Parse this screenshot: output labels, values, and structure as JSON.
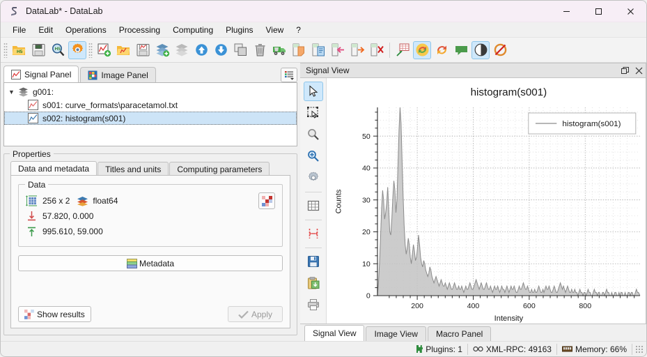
{
  "window": {
    "title": "DataLab* - DataLab",
    "app_icon": "datalab-icon",
    "minimize_label": "—",
    "maximize_label": "☐",
    "close_label": "✕"
  },
  "menubar": {
    "items": [
      {
        "label": "File"
      },
      {
        "label": "Edit"
      },
      {
        "label": "Operations"
      },
      {
        "label": "Processing"
      },
      {
        "label": "Computing"
      },
      {
        "label": "Plugins"
      },
      {
        "label": "View"
      },
      {
        "label": "?"
      }
    ]
  },
  "toolbar": {
    "groups": [
      [
        {
          "name": "open-hdf5-button",
          "icon": "folder-open-h5-icon"
        },
        {
          "name": "save-hdf5-button",
          "icon": "floppy-save-h5-icon"
        },
        {
          "name": "browse-hdf5-button",
          "icon": "magnifier-h5-icon"
        },
        {
          "name": "settings-button",
          "icon": "gear-orange-icon",
          "active": true
        }
      ],
      [
        {
          "name": "new-signal-button",
          "icon": "new-signal-icon"
        },
        {
          "name": "open-signal-button",
          "icon": "folder-signal-icon"
        },
        {
          "name": "save-signal-button",
          "icon": "floppy-signal-icon"
        },
        {
          "name": "new-group-button",
          "icon": "layers-add-icon"
        },
        {
          "name": "group-button",
          "icon": "layers-icon"
        },
        {
          "name": "move-up-button",
          "icon": "arrow-up-circle-icon"
        },
        {
          "name": "move-down-button",
          "icon": "arrow-down-circle-icon"
        },
        {
          "name": "duplicate-button",
          "icon": "duplicate-icon"
        },
        {
          "name": "delete-button",
          "icon": "trash-icon"
        },
        {
          "name": "delete-all-button",
          "icon": "truck-icon"
        },
        {
          "name": "copy-metadata-button",
          "icon": "copy-metadata-icon"
        },
        {
          "name": "paste-metadata-button",
          "icon": "paste-metadata-icon"
        },
        {
          "name": "import-metadata-button",
          "icon": "import-arrow-icon"
        },
        {
          "name": "export-metadata-button",
          "icon": "export-arrow-icon"
        },
        {
          "name": "delete-metadata-button",
          "icon": "delete-metadata-icon"
        }
      ],
      [
        {
          "name": "plot-options-button",
          "icon": "chart-grid-icon"
        },
        {
          "name": "refresh-auto-button",
          "icon": "refresh-circle-icon",
          "active": true
        },
        {
          "name": "refresh-button",
          "icon": "refresh-arrow-icon"
        },
        {
          "name": "annotations-button",
          "icon": "comment-icon"
        },
        {
          "name": "curve-style-button",
          "icon": "contrast-circle-icon",
          "active": true
        },
        {
          "name": "no-curve-anti-aliasing-button",
          "icon": "crossed-circle-icon"
        }
      ]
    ]
  },
  "left_panel": {
    "tabs": [
      {
        "label": "Signal Panel",
        "icon": "signal-panel-icon",
        "active": true
      },
      {
        "label": "Image Panel",
        "icon": "image-panel-icon",
        "active": false
      }
    ],
    "list_options_button": "list-options-icon",
    "tree": [
      {
        "label": "g001:",
        "level": 0,
        "icon": "group-icon",
        "expanded": true,
        "selected": false
      },
      {
        "label": "s001: curve_formats\\paracetamol.txt",
        "level": 1,
        "icon": "signal-icon",
        "selected": false
      },
      {
        "label": "s002: histogram(s001)",
        "level": 1,
        "icon": "signal-icon",
        "selected": true
      }
    ]
  },
  "properties": {
    "legend": "Properties",
    "tabs": [
      {
        "label": "Data and metadata",
        "active": true
      },
      {
        "label": "Titles and units",
        "active": false
      },
      {
        "label": "Computing parameters",
        "active": false
      }
    ],
    "data_group_legend": "Data",
    "rows": [
      {
        "icon": "dimensions-icon",
        "text": "256 x 2",
        "dtype_icon": "datatype-icon",
        "dtype": "float64"
      },
      {
        "icon": "minimum-icon",
        "text": "57.820, 0.000"
      },
      {
        "icon": "maximum-icon",
        "text": "995.610, 59.000"
      }
    ],
    "colormap_button": "colormap-icon",
    "metadata_button": {
      "label": "Metadata",
      "icon": "metadata-icon"
    },
    "show_results_button": {
      "label": "Show results",
      "icon": "results-icon"
    },
    "apply_button": {
      "label": "Apply",
      "icon": "check-icon",
      "enabled": false
    }
  },
  "dock": {
    "title": "Signal View",
    "float_button": "restore-icon",
    "close_button": "close-icon"
  },
  "plot_tools": [
    {
      "name": "select-tool",
      "icon": "cursor-arrow-icon",
      "active": true
    },
    {
      "name": "rectangle-select-tool",
      "icon": "rectangle-select-icon",
      "active": false
    },
    {
      "name": "zoom-out-tool",
      "icon": "magnifier-gray-icon",
      "active": false
    },
    {
      "name": "zoom-in-tool",
      "icon": "magnifier-blue-icon",
      "active": false
    },
    {
      "name": "plot-settings-tool",
      "icon": "gear-gray-icon",
      "active": false
    },
    {
      "name": "grid-tool",
      "icon": "grid-icon",
      "active": false
    },
    {
      "name": "x-range-tool",
      "icon": "x-range-icon",
      "active": false
    },
    {
      "name": "save-plot-tool",
      "icon": "floppy-blue-icon",
      "active": false
    },
    {
      "name": "copy-plot-tool",
      "icon": "clipboard-icon",
      "active": false
    },
    {
      "name": "print-plot-tool",
      "icon": "printer-icon",
      "active": false
    },
    {
      "name": "more-tools",
      "icon": "chevron-double-down-icon",
      "active": false
    }
  ],
  "view_tabs": [
    {
      "label": "Signal View",
      "active": true
    },
    {
      "label": "Image View",
      "active": false
    },
    {
      "label": "Macro Panel",
      "active": false
    }
  ],
  "statusbar": [
    {
      "name": "plugins-status",
      "icon": "plugin-icon",
      "text": "Plugins: 1"
    },
    {
      "name": "xmlrpc-status",
      "icon": "link-icon",
      "text": "XML-RPC: 49163"
    },
    {
      "name": "memory-status",
      "icon": "memory-icon",
      "text": "Memory: 66%"
    }
  ],
  "chart_data": {
    "type": "area",
    "title": "histogram(s001)",
    "xlabel": "Intensity",
    "ylabel": "Counts",
    "legend": [
      "histogram(s001)"
    ],
    "legend_position": "top-right",
    "grid": true,
    "xlim": [
      57.82,
      995.61
    ],
    "ylim": [
      0,
      59
    ],
    "xticks": [
      200,
      400,
      600,
      800
    ],
    "yticks": [
      0,
      10,
      20,
      30,
      40,
      50
    ],
    "line_color": "#8c8c8c",
    "fill_color": "#c3c3c3",
    "series": [
      {
        "name": "histogram(s001)",
        "x": [
          57.8,
          61.5,
          65.1,
          68.8,
          72.5,
          76.2,
          79.8,
          83.5,
          87.2,
          90.8,
          94.5,
          98.2,
          101.8,
          105.5,
          109.2,
          112.9,
          116.5,
          120.2,
          123.9,
          127.5,
          131.2,
          134.9,
          138.6,
          142.2,
          145.9,
          149.6,
          153.2,
          156.9,
          160.6,
          164.3,
          167.9,
          171.6,
          175.3,
          178.9,
          182.6,
          186.3,
          190.0,
          193.6,
          197.3,
          201.0,
          204.6,
          208.3,
          212.0,
          215.7,
          219.3,
          223.0,
          226.7,
          230.3,
          234.0,
          237.7,
          241.4,
          245.0,
          248.7,
          252.4,
          256.0,
          259.7,
          263.4,
          267.1,
          270.7,
          274.4,
          278.1,
          281.7,
          285.4,
          289.1,
          292.8,
          296.4,
          300.1,
          303.8,
          307.4,
          311.1,
          314.8,
          318.5,
          322.1,
          325.8,
          329.5,
          333.1,
          336.8,
          340.5,
          344.2,
          347.8,
          351.5,
          355.2,
          358.8,
          362.5,
          366.2,
          369.9,
          373.5,
          377.2,
          380.9,
          384.5,
          388.2,
          391.9,
          395.6,
          399.2,
          402.9,
          406.6,
          410.2,
          413.9,
          417.6,
          421.3,
          424.9,
          428.6,
          432.3,
          435.9,
          439.6,
          443.3,
          447.0,
          450.6,
          454.3,
          458.0,
          461.6,
          465.3,
          469.0,
          472.7,
          476.3,
          480.0,
          483.7,
          487.3,
          491.0,
          494.7,
          498.4,
          502.0,
          505.7,
          509.4,
          513.0,
          516.7,
          520.4,
          524.1,
          527.7,
          531.4,
          535.1,
          538.7,
          542.4,
          546.1,
          549.8,
          553.4,
          557.1,
          560.8,
          564.4,
          568.1,
          571.8,
          575.5,
          579.1,
          582.8,
          586.5,
          590.1,
          593.8,
          597.5,
          601.2,
          604.8,
          608.5,
          612.2,
          615.8,
          619.5,
          623.2,
          626.9,
          630.5,
          634.2,
          637.9,
          641.5,
          645.2,
          648.9,
          652.6,
          656.2,
          659.9,
          663.6,
          667.2,
          670.9,
          674.6,
          678.3,
          681.9,
          685.6,
          689.3,
          692.9,
          696.6,
          700.3,
          704.0,
          707.6,
          711.3,
          715.0,
          718.6,
          722.3,
          726.0,
          729.7,
          733.3,
          737.0,
          740.7,
          744.3,
          748.0,
          751.7,
          755.4,
          759.0,
          762.7,
          766.4,
          770.0,
          773.7,
          777.4,
          781.1,
          784.7,
          788.4,
          792.1,
          795.7,
          799.4,
          803.1,
          806.8,
          810.4,
          814.1,
          817.8,
          821.4,
          825.1,
          828.8,
          832.5,
          836.1,
          839.8,
          843.5,
          847.1,
          850.8,
          854.5,
          858.2,
          861.8,
          865.5,
          869.2,
          872.8,
          876.5,
          880.2,
          883.9,
          887.5,
          891.2,
          894.9,
          898.5,
          902.2,
          905.9,
          909.6,
          913.2,
          916.9,
          920.6,
          924.2,
          927.9,
          931.6,
          935.3,
          938.9,
          942.6,
          946.3,
          949.9,
          953.6,
          957.3,
          961.0,
          964.6,
          968.3,
          972.0,
          975.6,
          979.3,
          983.0,
          986.7,
          990.3,
          995.6
        ],
        "y": [
          0,
          4,
          10,
          18,
          27,
          33,
          30,
          24,
          26,
          29,
          34,
          27,
          20,
          19,
          24,
          31,
          36,
          33,
          26,
          30,
          41,
          52,
          59,
          54,
          42,
          31,
          22,
          16,
          13,
          15,
          18,
          16,
          12,
          10,
          13,
          16,
          14,
          11,
          12,
          15,
          19,
          16,
          12,
          10,
          9,
          11,
          10,
          8,
          7,
          6,
          7,
          9,
          8,
          6,
          5,
          4,
          5,
          6,
          5,
          4,
          3,
          4,
          5,
          4,
          3,
          3,
          4,
          3,
          2,
          3,
          4,
          3,
          2,
          2,
          3,
          4,
          3,
          2,
          2,
          3,
          2,
          2,
          3,
          2,
          1,
          2,
          3,
          2,
          2,
          3,
          4,
          3,
          2,
          2,
          3,
          4,
          5,
          4,
          3,
          2,
          3,
          4,
          3,
          2,
          2,
          3,
          4,
          3,
          2,
          2,
          3,
          2,
          1,
          2,
          3,
          2,
          2,
          3,
          2,
          1,
          2,
          3,
          2,
          2,
          1,
          2,
          3,
          2,
          1,
          2,
          3,
          2,
          2,
          3,
          2,
          1,
          1,
          2,
          3,
          2,
          2,
          3,
          4,
          3,
          2,
          2,
          3,
          2,
          1,
          1,
          2,
          1,
          1,
          2,
          1,
          1,
          2,
          3,
          2,
          1,
          1,
          2,
          1,
          2,
          3,
          2,
          2,
          3,
          2,
          1,
          1,
          2,
          3,
          2,
          1,
          1,
          2,
          3,
          4,
          3,
          2,
          3,
          2,
          1,
          2,
          3,
          2,
          1,
          1,
          2,
          1,
          1,
          2,
          1,
          1,
          0,
          1,
          2,
          1,
          1,
          0,
          1,
          1,
          0,
          1,
          2,
          1,
          1,
          0,
          0,
          1,
          2,
          1,
          1,
          0,
          1,
          1,
          0,
          0,
          1,
          1,
          0,
          1,
          2,
          1,
          1,
          0,
          0,
          1,
          0,
          0,
          1,
          1,
          0,
          0,
          1,
          0,
          1,
          1,
          0,
          0,
          1,
          0,
          0,
          1,
          1,
          0,
          1,
          1,
          0,
          0,
          1,
          2,
          1,
          1,
          0
        ]
      }
    ]
  }
}
